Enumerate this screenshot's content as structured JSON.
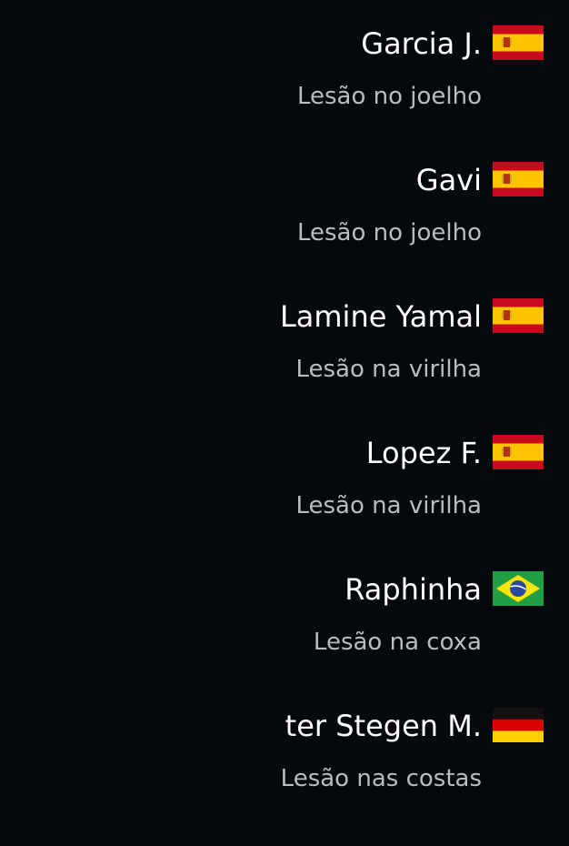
{
  "players": [
    {
      "name": "Garcia J.",
      "reason": "Lesão no joelho",
      "flag_icon": "spain-flag-icon",
      "country": "es"
    },
    {
      "name": "Gavi",
      "reason": "Lesão no joelho",
      "flag_icon": "spain-flag-icon",
      "country": "es"
    },
    {
      "name": "Lamine Yamal",
      "reason": "Lesão na virilha",
      "flag_icon": "spain-flag-icon",
      "country": "es"
    },
    {
      "name": "Lopez F.",
      "reason": "Lesão na virilha",
      "flag_icon": "spain-flag-icon",
      "country": "es"
    },
    {
      "name": "Raphinha",
      "reason": "Lesão na coxa",
      "flag_icon": "brazil-flag-icon",
      "country": "br"
    },
    {
      "name": "ter Stegen M.",
      "reason": "Lesão nas costas",
      "flag_icon": "germany-flag-icon",
      "country": "de"
    }
  ],
  "colors": {
    "background": "#05090e",
    "name_text": "#ffffff",
    "reason_text": "#b9bcc1"
  }
}
